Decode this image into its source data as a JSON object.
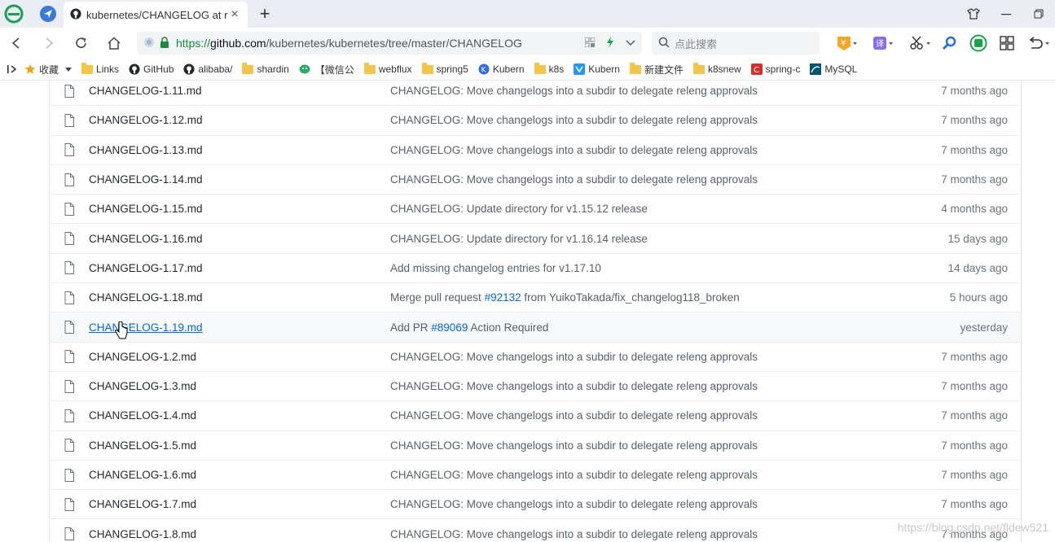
{
  "tab": {
    "title": "kubernetes/CHANGELOG at r",
    "close": "×",
    "new": "+"
  },
  "address": {
    "url_prefix": "https://",
    "url_host": "github.com",
    "url_path": "/kubernetes/kubernetes/tree/master/CHANGELOG"
  },
  "search": {
    "placeholder": "点此搜索"
  },
  "bookmarks": [
    {
      "label": "收藏",
      "icon": "star-icon"
    },
    {
      "label": "Links",
      "icon": "folder-icon"
    },
    {
      "label": "GitHub",
      "icon": "github-icon"
    },
    {
      "label": "alibaba/",
      "icon": "github-icon"
    },
    {
      "label": "shardin",
      "icon": "folder-icon"
    },
    {
      "label": "【微信公",
      "icon": "wechat-icon"
    },
    {
      "label": "webflux",
      "icon": "folder-icon"
    },
    {
      "label": "spring5",
      "icon": "folder-icon"
    },
    {
      "label": "Kubern",
      "icon": "kubernetes-icon"
    },
    {
      "label": "k8s",
      "icon": "folder-icon"
    },
    {
      "label": "Kubern",
      "icon": "bookmark-icon"
    },
    {
      "label": "新建文件",
      "icon": "folder-icon"
    },
    {
      "label": "k8snew",
      "icon": "folder-icon"
    },
    {
      "label": "spring-c",
      "icon": "site-c-icon"
    },
    {
      "label": "MySQL",
      "icon": "mysql-icon"
    }
  ],
  "files": [
    {
      "name": "CHANGELOG-1.11.md",
      "message": "CHANGELOG: Move changelogs into a subdir to delegate releng approvals",
      "age": "7 months ago"
    },
    {
      "name": "CHANGELOG-1.12.md",
      "message": "CHANGELOG: Move changelogs into a subdir to delegate releng approvals",
      "age": "7 months ago"
    },
    {
      "name": "CHANGELOG-1.13.md",
      "message": "CHANGELOG: Move changelogs into a subdir to delegate releng approvals",
      "age": "7 months ago"
    },
    {
      "name": "CHANGELOG-1.14.md",
      "message": "CHANGELOG: Move changelogs into a subdir to delegate releng approvals",
      "age": "7 months ago"
    },
    {
      "name": "CHANGELOG-1.15.md",
      "message": "CHANGELOG: Update directory for v1.15.12 release",
      "age": "4 months ago"
    },
    {
      "name": "CHANGELOG-1.16.md",
      "message": "CHANGELOG: Update directory for v1.16.14 release",
      "age": "15 days ago"
    },
    {
      "name": "CHANGELOG-1.17.md",
      "message": "Add missing changelog entries for v1.17.10",
      "age": "14 days ago"
    },
    {
      "name": "CHANGELOG-1.18.md",
      "message_pre": "Merge pull request ",
      "pr": "#92132",
      "message_post": " from YuikoTakada/fix_changelog118_broken",
      "age": "5 hours ago"
    },
    {
      "name": "CHANGELOG-1.19.md",
      "message_pre": "Add PR ",
      "pr": "#89069",
      "message_post": " Action Required",
      "age": "yesterday"
    },
    {
      "name": "CHANGELOG-1.2.md",
      "message": "CHANGELOG: Move changelogs into a subdir to delegate releng approvals",
      "age": "7 months ago"
    },
    {
      "name": "CHANGELOG-1.3.md",
      "message": "CHANGELOG: Move changelogs into a subdir to delegate releng approvals",
      "age": "7 months ago"
    },
    {
      "name": "CHANGELOG-1.4.md",
      "message": "CHANGELOG: Move changelogs into a subdir to delegate releng approvals",
      "age": "7 months ago"
    },
    {
      "name": "CHANGELOG-1.5.md",
      "message": "CHANGELOG: Move changelogs into a subdir to delegate releng approvals",
      "age": "7 months ago"
    },
    {
      "name": "CHANGELOG-1.6.md",
      "message": "CHANGELOG: Move changelogs into a subdir to delegate releng approvals",
      "age": "7 months ago"
    },
    {
      "name": "CHANGELOG-1.7.md",
      "message": "CHANGELOG: Move changelogs into a subdir to delegate releng approvals",
      "age": "7 months ago"
    },
    {
      "name": "CHANGELOG-1.8.md",
      "message": "CHANGELOG: Move changelogs into a subdir to delegate releng approvals",
      "age": "7 months ago"
    }
  ],
  "hovered_file": "CHANGELOG-1.19.md",
  "watermark": "https://blog.csdn.net/fldew521",
  "colors": {
    "link": "#0366d6",
    "muted": "#586069",
    "secure_url": "#1a8c3a"
  }
}
